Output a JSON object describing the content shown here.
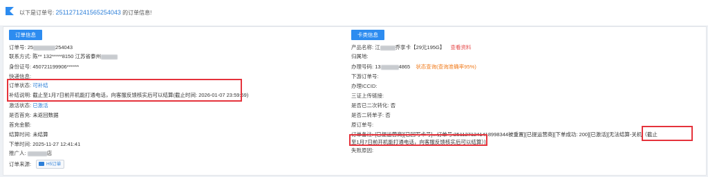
{
  "header": {
    "prefix": "以下是订单号:",
    "order_no": "2511271241565254043",
    "suffix": "的订单信息!"
  },
  "left": {
    "tag": "订单信息",
    "rows": [
      {
        "label": "订单号:",
        "value": "25",
        "value2": "254043"
      },
      {
        "label": "联系方式:",
        "value": "陈**  132*****8150  江苏省泰州"
      },
      {
        "label": "身份证号:",
        "value": "450721199906******"
      },
      {
        "label": "快递信息:",
        "value": ""
      },
      {
        "label": "订单状态:",
        "value": "可补结"
      },
      {
        "label": "补结说明:",
        "value": "截止至1月7日前开机能打通电话，向客服反馈核实后可以结算(截止时间: 2026-01-07 23:59:59)"
      },
      {
        "label": "激活状态:",
        "value": "已激活"
      },
      {
        "label": "是否首充:",
        "value": "未返回数据"
      },
      {
        "label": "首充金额:",
        "value": ""
      },
      {
        "label": "结算时间:",
        "value": "未结算"
      },
      {
        "label": "下单时间:",
        "value": "2025-11-27 12:41:41"
      },
      {
        "label": "推广人:",
        "value": "店"
      },
      {
        "label": "订单来源:",
        "value": "H5订单"
      }
    ]
  },
  "right": {
    "tag": "卡类信息",
    "rows": [
      {
        "label": "产品名称:",
        "value": "江",
        "value2": "乔享卡【29元195G】",
        "link": "查看资料"
      },
      {
        "label": "归属地:",
        "value": ""
      },
      {
        "label": "办理号码:",
        "value": "13",
        "value2": "4865",
        "status": "状态查询(查询准确率95%)"
      },
      {
        "label": "下游订单号:",
        "value": ""
      },
      {
        "label": "办理ICCID:",
        "value": ""
      },
      {
        "label": "三证上传链接:",
        "value": ""
      },
      {
        "label": "是否已二次转化:",
        "value": "否"
      },
      {
        "label": "是否二转单子:",
        "value": "否"
      },
      {
        "label": "原订单号:",
        "value": ""
      },
      {
        "label": "订单备注:",
        "value": "[已提运营商][已回写卡号]...订单号:2511271241418998344被重置][已提运营商][下单成功: 200][已激活][无法结算-关机（截止"
      },
      {
        "label": "",
        "value": "至1月7日前开机能打通电话，向客服反馈核实后可以结算）]"
      },
      {
        "label": "失败原因:",
        "value": ""
      }
    ]
  },
  "colors": {
    "accent": "#2d8cf0",
    "link": "#2d7fd8",
    "warning": "#f07a1a",
    "highlight": "#e5323b"
  }
}
